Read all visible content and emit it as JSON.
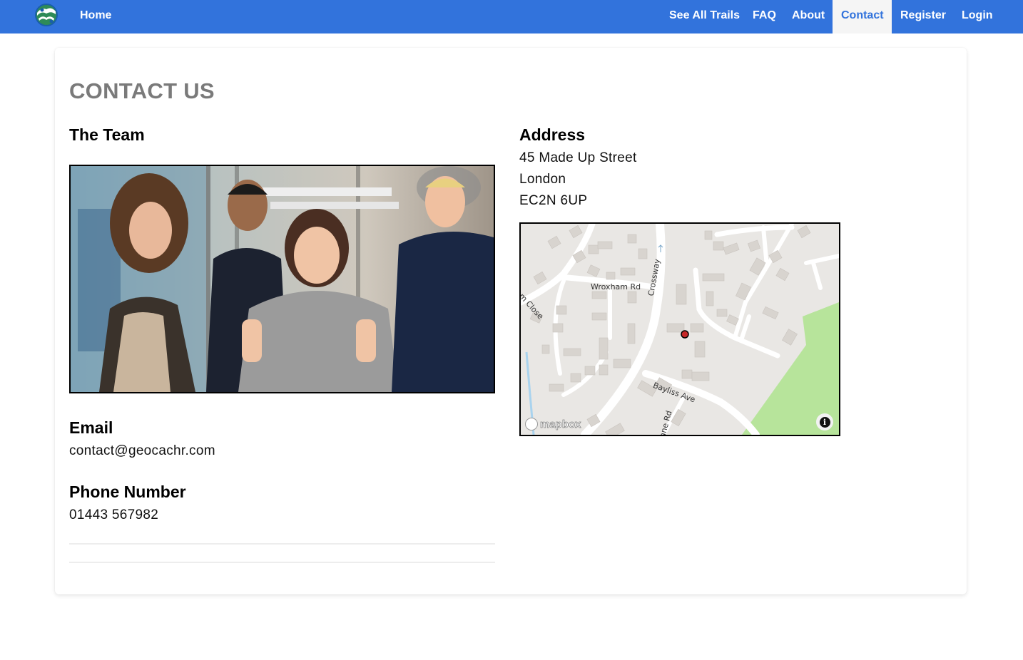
{
  "nav": {
    "home": "Home",
    "items": [
      "See All Trails",
      "FAQ",
      "About",
      "Contact",
      "Register",
      "Login"
    ],
    "active": "Contact",
    "bar_color": "#3273dc"
  },
  "page": {
    "title": "CONTACT US"
  },
  "team": {
    "heading": "The Team"
  },
  "email": {
    "heading": "Email",
    "value": "contact@geocachr.com"
  },
  "phone": {
    "heading": "Phone Number",
    "value": "01443 567982"
  },
  "address": {
    "heading": "Address",
    "line1": "45 Made Up Street",
    "line2": "London",
    "line3": "EC2N 6UP"
  },
  "map": {
    "streets": [
      "Wroxham Rd",
      "Crossway",
      "Bayliss Ave",
      "am Close",
      "ane Rd"
    ],
    "attribution": "mapbox",
    "info_icon": "info-icon"
  }
}
